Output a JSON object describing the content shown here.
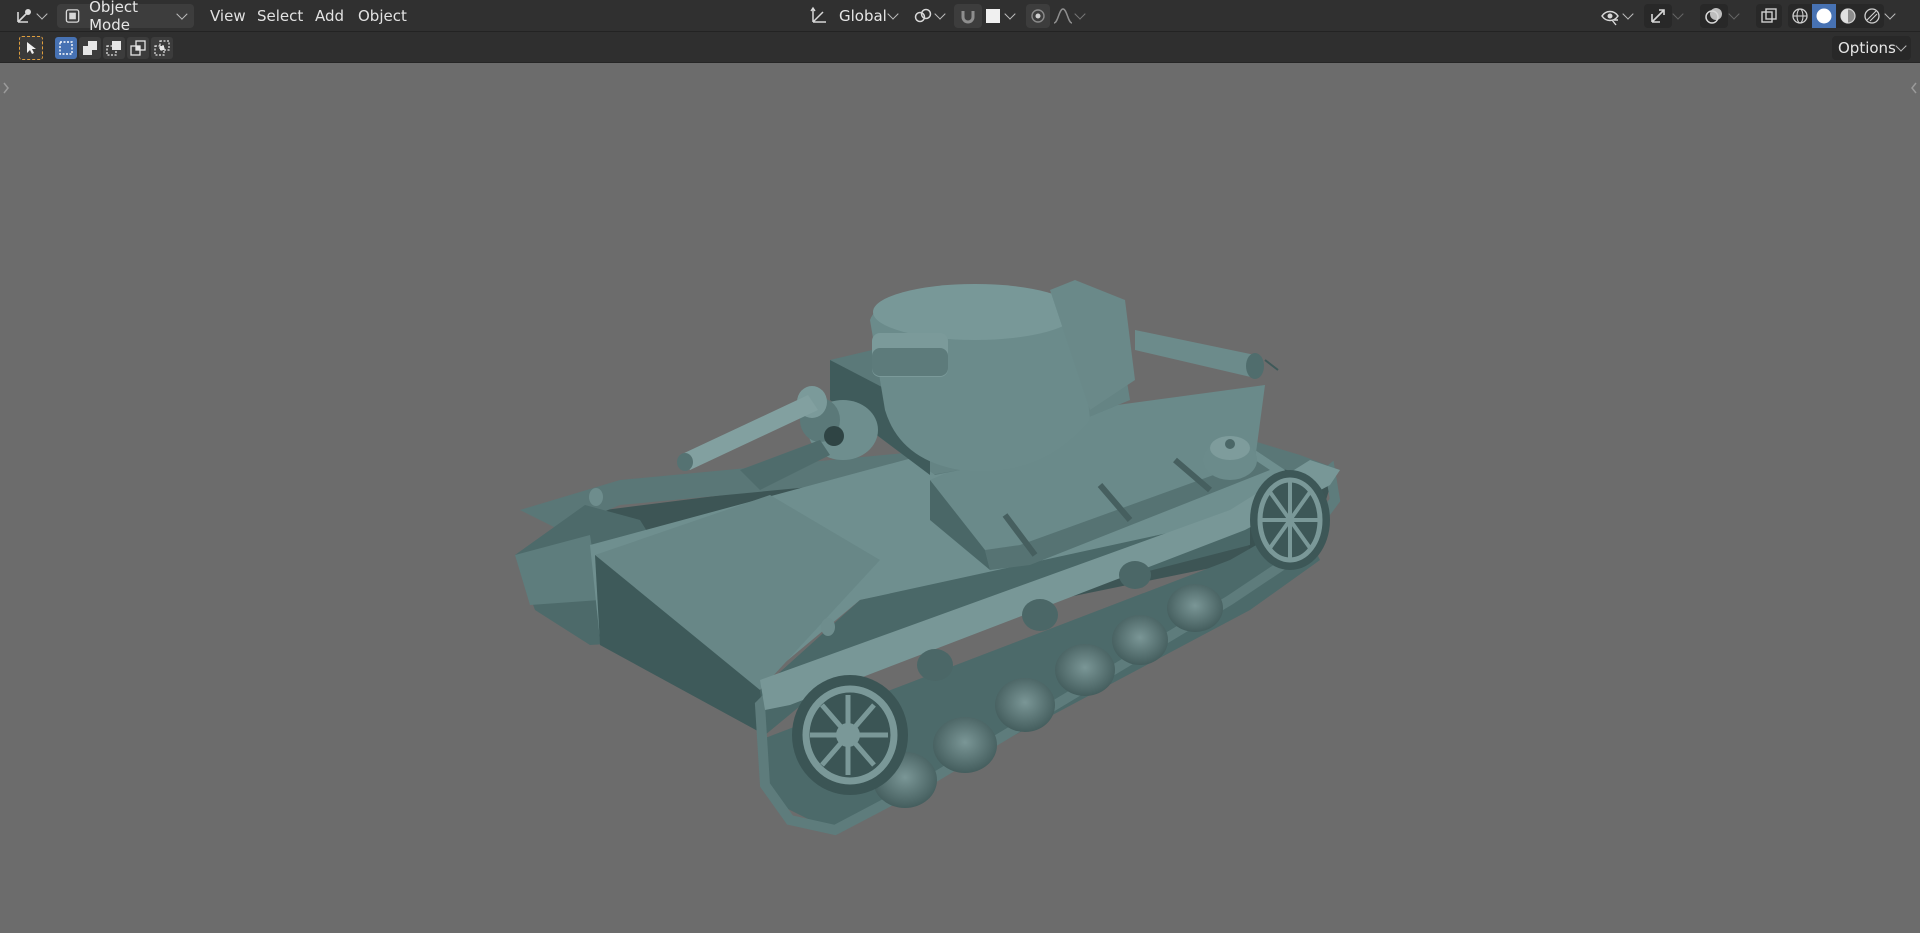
{
  "header": {
    "mode_label": "Object Mode",
    "menus": [
      "View",
      "Select",
      "Add",
      "Object"
    ],
    "transform_orientation": "Global"
  },
  "toolbar": {
    "options_label": "Options"
  },
  "icons": {
    "editor_type": "3d-viewport-icon",
    "mode": "object-mode-icon",
    "orientation": "transform-orientation-icon",
    "pivot": "pivot-point-icon",
    "snap": "snap-icon",
    "snap_target": "snap-increment-icon",
    "proportional": "proportional-editing-icon",
    "falloff": "falloff-curve-icon",
    "visibility": "visibility-eye-icon",
    "gizmo": "gizmo-icon",
    "overlay": "overlay-icon",
    "xray": "xray-icon",
    "shading_modes": [
      "wireframe-shading-icon",
      "solid-shading-icon",
      "material-preview-icon",
      "rendered-shading-icon"
    ]
  },
  "colors": {
    "viewport_bg": "#6c6c6c",
    "header_bg": "#303030",
    "accent_blue": "#4772b3",
    "active_tool": "#e09f3e",
    "model": "#5d7a7a"
  }
}
